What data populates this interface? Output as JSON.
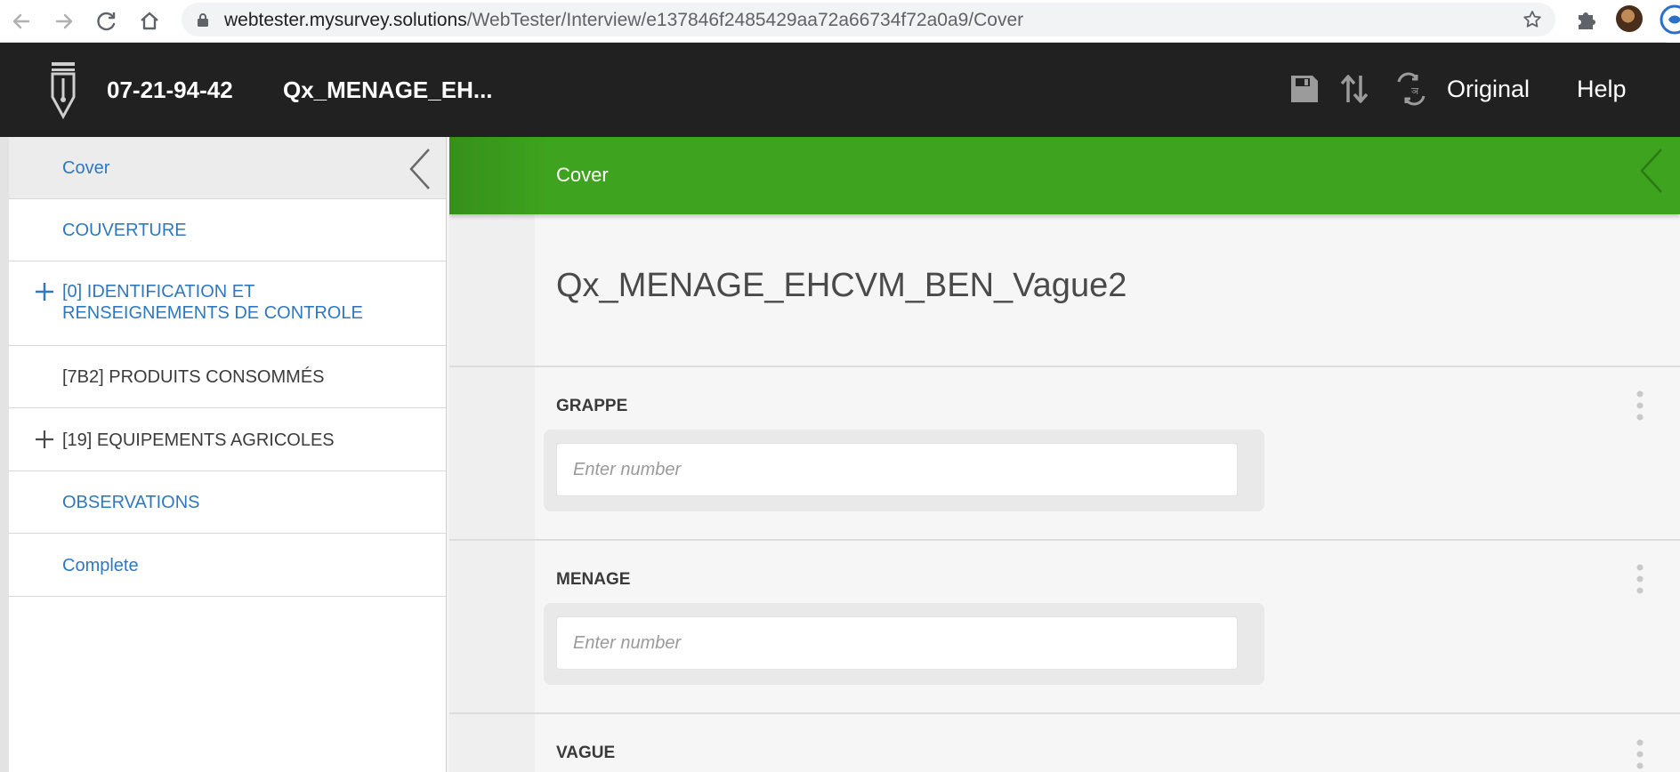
{
  "browser": {
    "url_host": "webtester.mysurvey.solutions",
    "url_path": "/WebTester/Interview/e137846f2485429aa72a66734f72a0a9/Cover"
  },
  "header": {
    "interview_id": "07-21-94-42",
    "questionnaire_short": "Qx_MENAGE_EH...",
    "language_label": "Original",
    "help_label": "Help",
    "background_color": "#212121"
  },
  "sidebar": {
    "items": [
      {
        "label": "Cover"
      },
      {
        "label": "COUVERTURE"
      },
      {
        "label_line1": "[0] IDENTIFICATION ET",
        "label_line2": "RENSEIGNEMENTS DE CONTROLE"
      },
      {
        "label": "[7B2] PRODUITS CONSOMMÉS"
      },
      {
        "label": "[19] EQUIPEMENTS AGRICOLES"
      },
      {
        "label": "OBSERVATIONS"
      },
      {
        "label": "Complete"
      }
    ],
    "link_color": "#2f78c0"
  },
  "main": {
    "section_title": "Cover",
    "section_color": "#3ea31e",
    "questionnaire_title": "Qx_MENAGE_EHCVM_BEN_Vague2",
    "questions": [
      {
        "label": "GRAPPE",
        "placeholder": "Enter number"
      },
      {
        "label": "MENAGE",
        "placeholder": "Enter number"
      },
      {
        "label": "VAGUE"
      }
    ]
  }
}
